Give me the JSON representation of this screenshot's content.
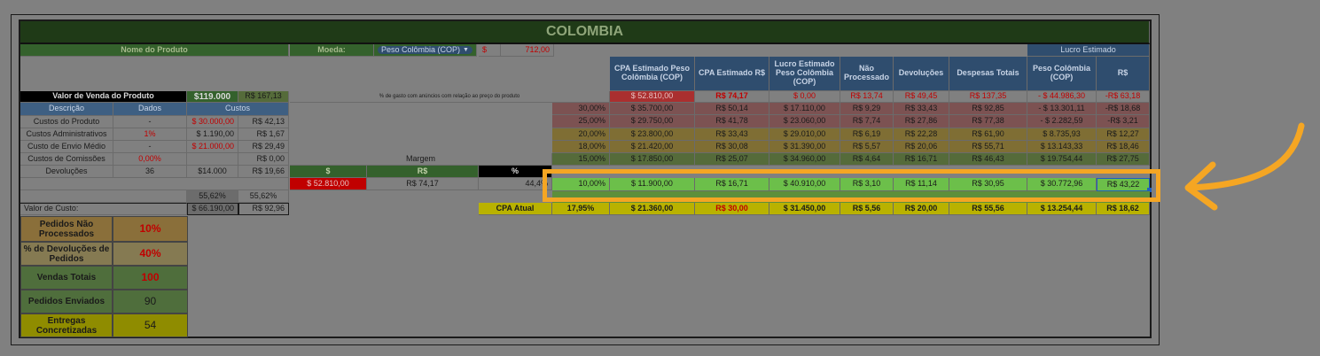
{
  "title": "COLOMBIA",
  "header": {
    "nome_produto": "Nome do Produto",
    "moeda_label": "Moeda:",
    "moeda_value": "Peso Colômbia (COP)",
    "price_symbol": "$",
    "price_value": "712,00",
    "lucro_estimado": "Lucro Estimado"
  },
  "columns": [
    "CPA Estimado Peso Colômbia (COP)",
    "CPA Estimado R$",
    "Lucro Estimado Peso Colômbia (COP)",
    "Não Processado",
    "Devoluções",
    "Despesas Totais",
    "Peso Colômbia (COP)",
    "R$"
  ],
  "venda": {
    "label": "Valor de Venda do Produto",
    "cop": "$119.000",
    "brl": "R$ 167,13",
    "note": "% de gasto com anúncios com relação ao preço do produto"
  },
  "costs_header": {
    "desc": "Descrição",
    "dados": "Dados",
    "custos": "Custos"
  },
  "costs": [
    {
      "desc": "Custos do Produto",
      "dados": "-",
      "cop": "$ 30.000,00",
      "brl": "R$ 42,13"
    },
    {
      "desc": "Custos Administrativos",
      "dados": "1%",
      "cop": "$ 1.190,00",
      "brl": "R$ 1,67"
    },
    {
      "desc": "Custo de Envio Médio",
      "dados": "-",
      "cop": "$ 21.000,00",
      "brl": "R$ 29,49"
    },
    {
      "desc": "Custos de Comissões",
      "dados": "0,00%",
      "cop": "",
      "brl": "R$ 0,00"
    },
    {
      "desc": "Devoluções",
      "dados": "36",
      "cop": "$14.000",
      "brl": "R$ 19,66"
    }
  ],
  "pct_row": {
    "a": "55,62%",
    "b": "55,62%"
  },
  "valor_custo": {
    "label": "Valor de Custo:",
    "cop": "$ 66.190,00",
    "brl": "R$ 92,96"
  },
  "margem": {
    "label": "Margem",
    "h1": "$",
    "h2": "R$",
    "h3": "%",
    "v1": "$ 52.810,00",
    "v2": "R$ 74,17",
    "v3": "44,4%"
  },
  "first_row": {
    "cpa_cop": "$ 52.810,00",
    "cpa_brl": "R$ 74,17",
    "lucro": "$ 0,00",
    "nao": "R$ 13,74",
    "dev": "R$ 49,45",
    "desp": "R$ 137,35",
    "peso": "- $ 44.986,30",
    "rs": "-R$ 63,18"
  },
  "rows": [
    {
      "pct": "30,00%",
      "cpa_cop": "$ 35.700,00",
      "cpa_brl": "R$ 50,14",
      "lucro": "$ 17.110,00",
      "nao": "R$ 9,29",
      "dev": "R$ 33,43",
      "desp": "R$ 92,85",
      "peso": "- $ 13.301,11",
      "rs": "-R$ 18,68"
    },
    {
      "pct": "25,00%",
      "cpa_cop": "$ 29.750,00",
      "cpa_brl": "R$ 41,78",
      "lucro": "$ 23.060,00",
      "nao": "R$ 7,74",
      "dev": "R$ 27,86",
      "desp": "R$ 77,38",
      "peso": "- $ 2.282,59",
      "rs": "-R$ 3,21"
    },
    {
      "pct": "20,00%",
      "cpa_cop": "$ 23.800,00",
      "cpa_brl": "R$ 33,43",
      "lucro": "$ 29.010,00",
      "nao": "R$ 6,19",
      "dev": "R$ 22,28",
      "desp": "R$ 61,90",
      "peso": "$ 8.735,93",
      "rs": "R$ 12,27"
    },
    {
      "pct": "18,00%",
      "cpa_cop": "$ 21.420,00",
      "cpa_brl": "R$ 30,08",
      "lucro": "$ 31.390,00",
      "nao": "R$ 5,57",
      "dev": "R$ 20,06",
      "desp": "R$ 55,71",
      "peso": "$ 13.143,33",
      "rs": "R$ 18,46"
    },
    {
      "pct": "15,00%",
      "cpa_cop": "$ 17.850,00",
      "cpa_brl": "R$ 25,07",
      "lucro": "$ 34.960,00",
      "nao": "R$ 4,64",
      "dev": "R$ 16,71",
      "desp": "R$ 46,43",
      "peso": "$ 19.754,44",
      "rs": "R$ 27,75"
    },
    {
      "pct": "10,00%",
      "cpa_cop": "$ 11.900,00",
      "cpa_brl": "R$ 16,71",
      "lucro": "$ 40.910,00",
      "nao": "R$ 3,10",
      "dev": "R$ 11,14",
      "desp": "R$ 30,95",
      "peso": "$ 30.772,96",
      "rs": "R$ 43,22"
    }
  ],
  "cpa_atual": {
    "label": "CPA Atual",
    "pct": "17,95%",
    "cpa_cop": "$ 21.360,00",
    "cpa_brl": "R$ 30,00",
    "lucro": "$ 31.450,00",
    "nao": "R$ 5,56",
    "dev": "R$ 20,00",
    "desp": "R$ 55,56",
    "peso": "$ 13.254,44",
    "rs": "R$ 18,62"
  },
  "stats": [
    {
      "label": "Pedidos Não Processados",
      "value": "10%"
    },
    {
      "label": "% de Devoluções de Pedidos",
      "value": "40%"
    },
    {
      "label": "Vendas Totais",
      "value": "100"
    },
    {
      "label": "Pedidos Enviados",
      "value": "90"
    },
    {
      "label": "Entregas Concretizadas",
      "value": "54"
    }
  ],
  "colors": {
    "highlight": "#f5a623",
    "title_bg": "#1f3a17"
  }
}
